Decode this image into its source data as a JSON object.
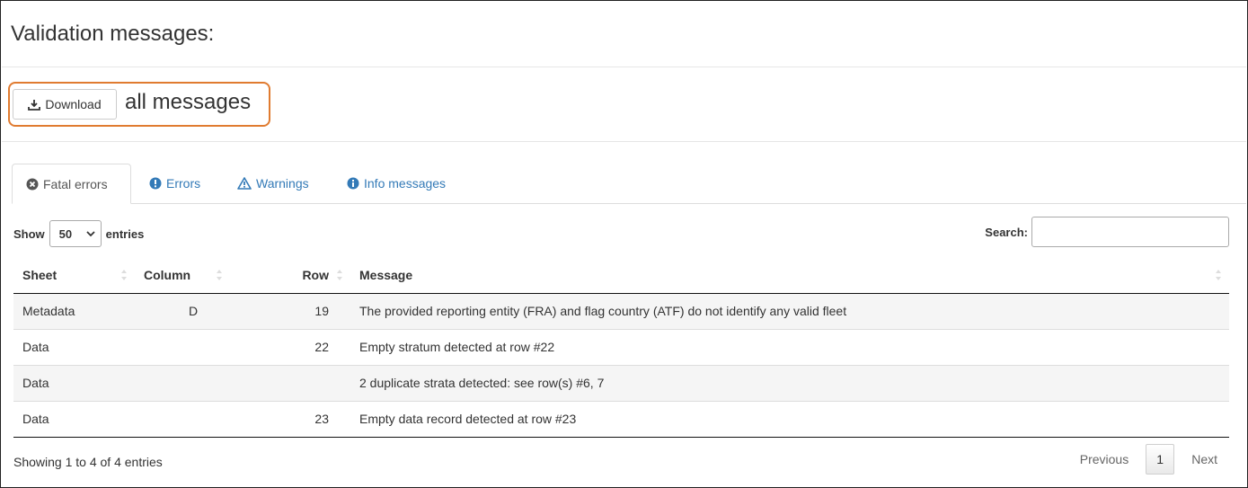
{
  "header": {
    "title": "Validation messages:"
  },
  "download": {
    "button_label": "Download",
    "suffix_text": "all messages",
    "highlight_color": "#e07b30"
  },
  "tabs": [
    {
      "label": "Fatal errors",
      "icon": "circle-x-icon",
      "active": true
    },
    {
      "label": "Errors",
      "icon": "exclamation-circle-icon",
      "active": false
    },
    {
      "label": "Warnings",
      "icon": "warning-triangle-icon",
      "active": false
    },
    {
      "label": "Info messages",
      "icon": "info-circle-icon",
      "active": false
    }
  ],
  "table_controls": {
    "show_label": "Show",
    "entries_value": "50",
    "entries_label": "entries",
    "search_label": "Search:",
    "search_value": ""
  },
  "table": {
    "columns": [
      "Sheet",
      "Column",
      "Row",
      "Message"
    ],
    "rows": [
      {
        "sheet": "Metadata",
        "column": "D",
        "row": "19",
        "message": "The provided reporting entity (FRA) and flag country (ATF) do not identify any valid fleet"
      },
      {
        "sheet": "Data",
        "column": "",
        "row": "22",
        "message": "Empty stratum detected at row #22"
      },
      {
        "sheet": "Data",
        "column": "",
        "row": "",
        "message": "2 duplicate strata detected: see row(s) #6, 7"
      },
      {
        "sheet": "Data",
        "column": "",
        "row": "23",
        "message": "Empty data record detected at row #23"
      }
    ]
  },
  "footer": {
    "info": "Showing 1 to 4 of 4 entries",
    "previous_label": "Previous",
    "current_page": "1",
    "next_label": "Next"
  },
  "colors": {
    "link": "#337ab7",
    "accent_border": "#e07b30"
  }
}
